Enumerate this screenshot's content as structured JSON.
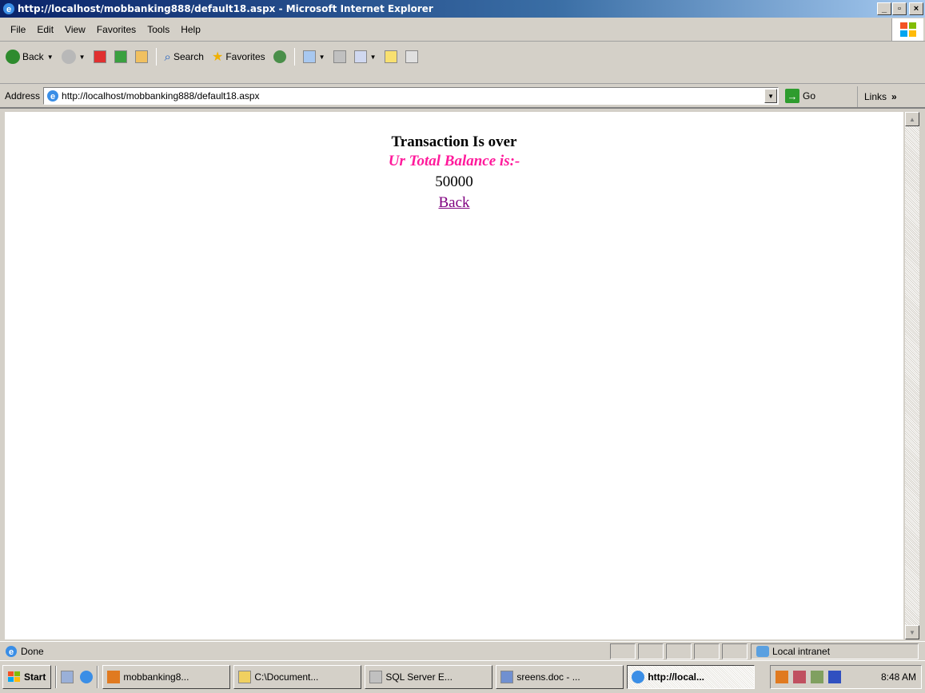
{
  "window": {
    "title": "http://localhost/mobbanking888/default18.aspx - Microsoft Internet Explorer"
  },
  "menu": {
    "items": [
      "File",
      "Edit",
      "View",
      "Favorites",
      "Tools",
      "Help"
    ]
  },
  "toolbar": {
    "back_label": "Back",
    "search_label": "Search",
    "favorites_label": "Favorites"
  },
  "address": {
    "label": "Address",
    "url": "http://localhost/mobbanking888/default18.aspx",
    "go_label": "Go",
    "links_label": "Links"
  },
  "content": {
    "heading": "Transaction Is over",
    "balance_label": "Ur Total Balance is:-",
    "balance_value": "50000",
    "back_link": "Back"
  },
  "status": {
    "text": "Done",
    "zone": "Local intranet"
  },
  "taskbar": {
    "start_label": "Start",
    "tasks": [
      "mobbanking8...",
      "C:\\Document...",
      "SQL Server E...",
      "sreens.doc - ...",
      "http://local..."
    ],
    "clock": "8:48 AM"
  },
  "colors": {
    "balance_label": "#ff1a9b",
    "visited_link": "#800080",
    "titlebar_start": "#0a246a"
  }
}
